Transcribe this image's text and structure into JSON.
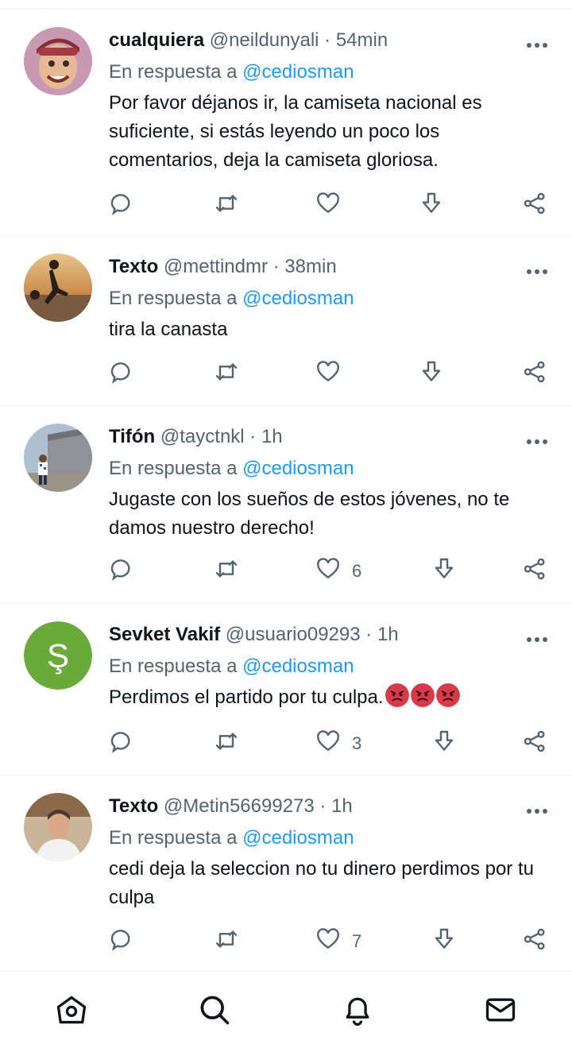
{
  "tweets": [
    {
      "name": "cualquiera",
      "handle": "@neildunyali",
      "time": "54min",
      "reply_prefix": "En respuesta a",
      "reply_to": "@cediosman",
      "text": "Por favor déjanos ir, la camiseta nacional es suficiente, si estás leyendo un poco los comentarios, deja la camiseta gloriosa.",
      "likes": ""
    },
    {
      "name": "Texto",
      "handle": "@mettindmr",
      "time": "38min",
      "reply_prefix": "En respuesta a",
      "reply_to": "@cediosman",
      "text": "tira la canasta",
      "likes": ""
    },
    {
      "name": "Tifón",
      "handle": "@tayctnkl",
      "time": "1h",
      "reply_prefix": "En respuesta a",
      "reply_to": "@cediosman",
      "text": "Jugaste con los sueños de estos jóvenes, no te damos nuestro derecho!",
      "likes": "6"
    },
    {
      "name": "Sevket Vakif",
      "handle": "@usuario09293",
      "time": "1h",
      "reply_prefix": "En respuesta a",
      "reply_to": "@cediosman",
      "text": "Perdimos el partido por tu culpa.",
      "avatar_letter": "Ş",
      "avatar_color": "#6aaa3a",
      "likes": "3"
    },
    {
      "name": "Texto",
      "handle": "@Metin56699273",
      "time": "1h",
      "reply_prefix": "En respuesta a",
      "reply_to": "@cediosman",
      "text": "cedi deja la seleccion no tu dinero perdimos por tu culpa",
      "likes": "7"
    }
  ],
  "separator": " · ",
  "icons": {
    "reply": "comment-icon",
    "retweet": "retweet-icon",
    "like": "heart-icon",
    "download": "download-icon",
    "share": "share-icon",
    "more": "more-icon"
  },
  "nav": [
    "home-icon",
    "search-icon",
    "notifications-icon",
    "messages-icon"
  ],
  "colors": {
    "text": "#0f1419",
    "secondary": "#536471",
    "link": "#1d9bf0",
    "angry_emoji": "#d83a4a"
  }
}
